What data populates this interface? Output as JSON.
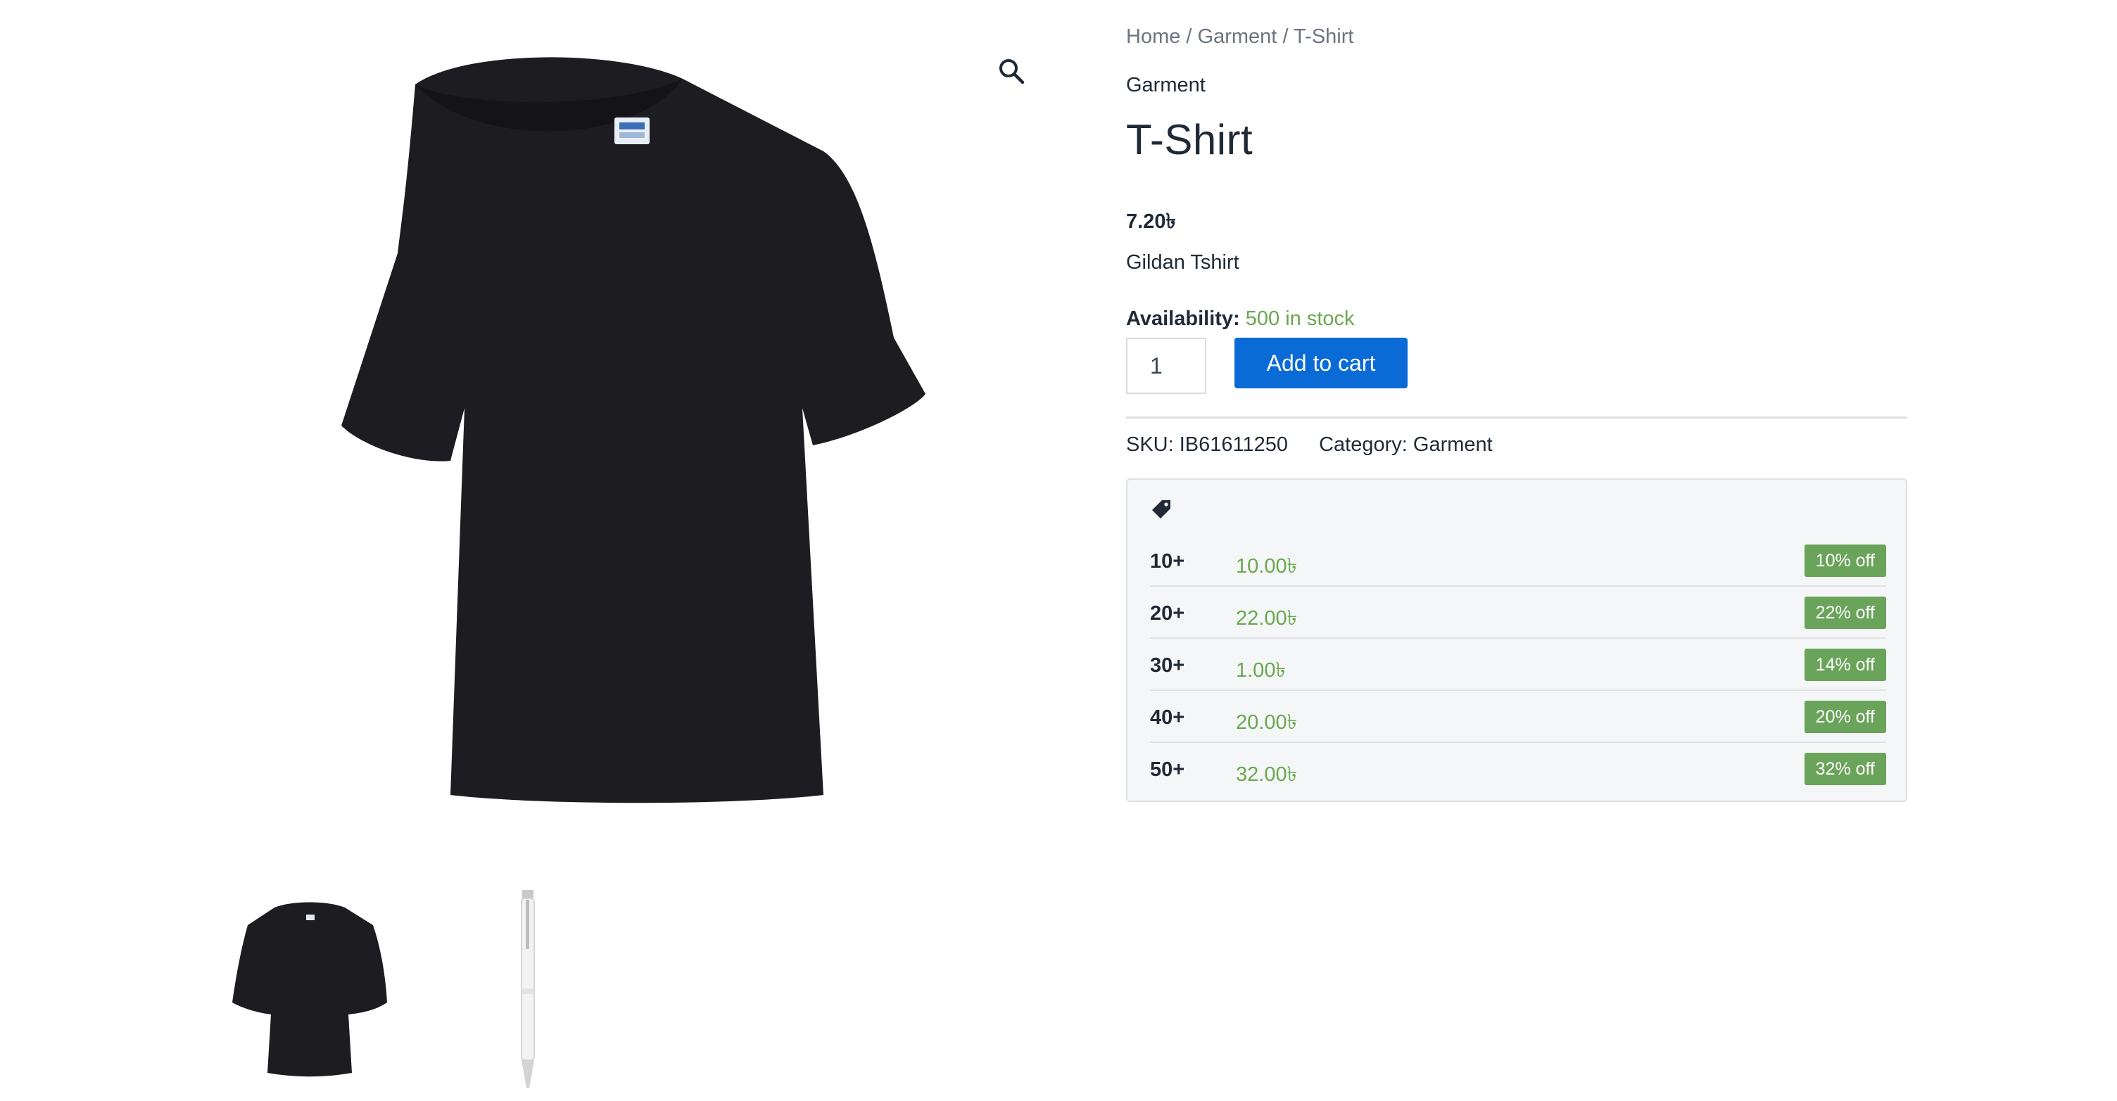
{
  "gallery": {
    "main_image": "black-tshirt-image",
    "zoom_icon": "magnifier-icon",
    "thumbnails": [
      "black-tshirt-thumbnail",
      "white-pen-thumbnail"
    ]
  },
  "breadcrumb": {
    "items": [
      "Home",
      "Garment",
      "T-Shirt"
    ],
    "separator": "/"
  },
  "product": {
    "category_link": "Garment",
    "title": "T-Shirt",
    "price": "7.20৳",
    "short_description": "Gildan Tshirt",
    "availability_label": "Availability:",
    "availability_value": "500 in stock",
    "quantity": "1",
    "add_to_cart_label": "Add to cart",
    "sku_label": "SKU:",
    "sku_value": "IB61611250",
    "category_label": "Category:",
    "category_value": "Garment"
  },
  "tiered_pricing": {
    "icon": "price-tag-icon",
    "rows": [
      {
        "qty": "10+",
        "price": "10.00৳",
        "discount": "10% off"
      },
      {
        "qty": "20+",
        "price": "22.00৳",
        "discount": "22% off"
      },
      {
        "qty": "30+",
        "price": "1.00৳",
        "discount": "14% off"
      },
      {
        "qty": "40+",
        "price": "20.00৳",
        "discount": "20% off"
      },
      {
        "qty": "50+",
        "price": "32.00৳",
        "discount": "32% off"
      }
    ]
  },
  "colors": {
    "accent_button": "#0a6ad6",
    "stock_green": "#6aa84f",
    "badge_green": "#6aa35a"
  }
}
